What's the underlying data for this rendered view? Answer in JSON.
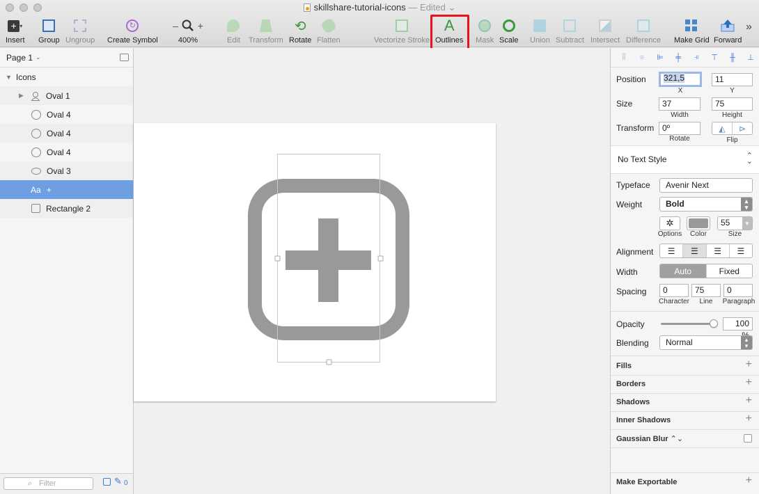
{
  "window": {
    "title": "skillshare-tutorial-icons",
    "edited": "— Edited"
  },
  "toolbar": {
    "insert": "Insert",
    "group": "Group",
    "ungroup": "Ungroup",
    "create_symbol": "Create Symbol",
    "zoom": "400%",
    "zoom_minus": "–",
    "zoom_plus": "+",
    "edit": "Edit",
    "transform": "Transform",
    "rotate": "Rotate",
    "flatten": "Flatten",
    "vectorize_stroke": "Vectorize Stroke",
    "outlines": "Outlines",
    "mask": "Mask",
    "scale": "Scale",
    "union": "Union",
    "subtract": "Subtract",
    "intersect": "Intersect",
    "difference": "Difference",
    "make_grid": "Make Grid",
    "forward": "Forward",
    "more": "»"
  },
  "layers": {
    "page": "Page 1",
    "group": "Icons",
    "items": [
      {
        "label": "Oval 1",
        "icon": "person-icon"
      },
      {
        "label": "Oval 4",
        "icon": "oval-icon"
      },
      {
        "label": "Oval 4",
        "icon": "oval-icon"
      },
      {
        "label": "Oval 4",
        "icon": "oval-icon"
      },
      {
        "label": "Oval 3",
        "icon": "speech-oval-icon"
      },
      {
        "label": "+",
        "icon": "text-icon",
        "icon_text": "Aa",
        "selected": true
      },
      {
        "label": "Rectangle 2",
        "icon": "rectangle-icon"
      }
    ],
    "filter_placeholder": "Filter",
    "edited_count": "0"
  },
  "inspector": {
    "position_label": "Position",
    "x": "321,5",
    "y": "11",
    "x_label": "X",
    "y_label": "Y",
    "size_label": "Size",
    "width": "37",
    "height": "75",
    "width_label": "Width",
    "height_label": "Height",
    "transform_label": "Transform",
    "rotate": "0º",
    "rotate_label": "Rotate",
    "flip_label": "Flip",
    "text_style": "No Text Style",
    "typeface_label": "Typeface",
    "typeface": "Avenir Next",
    "weight_label": "Weight",
    "weight": "Bold",
    "options_label": "Options",
    "color_label": "Color",
    "font_size": "55",
    "size_small_label": "Size",
    "alignment_label": "Alignment",
    "width_mode_label": "Width",
    "width_auto": "Auto",
    "width_fixed": "Fixed",
    "spacing_label": "Spacing",
    "character": "0",
    "line": "75",
    "paragraph": "0",
    "character_label": "Character",
    "line_label": "Line",
    "paragraph_label": "Paragraph",
    "opacity_label": "Opacity",
    "opacity": "100 %",
    "opacity_value": 1.0,
    "blending_label": "Blending",
    "blending": "Normal",
    "fills": "Fills",
    "borders": "Borders",
    "shadows": "Shadows",
    "inner_shadows": "Inner Shadows",
    "gaussian_blur": "Gaussian Blur",
    "make_exportable": "Make Exportable"
  },
  "colors": {
    "selection": "#6e9fe3",
    "highlight": "#e8131a",
    "icon_gray": "#999999",
    "green_tool": "#5cb85c"
  }
}
